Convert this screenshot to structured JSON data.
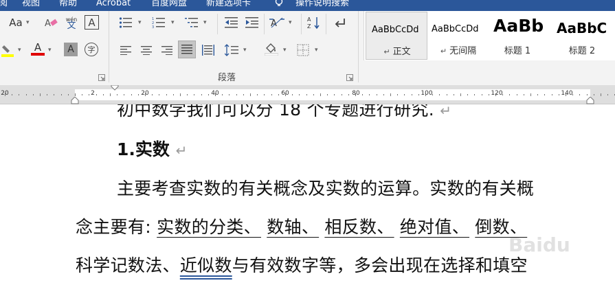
{
  "tabs": [
    "视图",
    "帮助",
    "Acrobat",
    "百度网盘",
    "新建选项卡",
    "操作说明搜索"
  ],
  "tabs_partial_left": "阅",
  "ribbon": {
    "font_size_label": "Aa",
    "phonetic_label": "wén\n文",
    "char_border_label": "A",
    "enclose_char_label": "字",
    "font_color_label": "A",
    "shading_label": "A",
    "paragraph_group_label": "段落"
  },
  "styles": [
    {
      "preview": "AaBbCcDd",
      "name": "正文",
      "selected": true
    },
    {
      "preview": "AaBbCcDd",
      "name": "无间隔",
      "selected": false
    },
    {
      "preview": "AaBb",
      "name": "标题 1",
      "selected": false
    },
    {
      "preview": "AaBbC",
      "name": "标题 2",
      "selected": false
    }
  ],
  "ruler": {
    "labels": [
      "20",
      "2",
      "20",
      "40",
      "60",
      "80",
      "100",
      "120",
      "140"
    ]
  },
  "document": {
    "line0": "初中数学我们可以分 18 个专题进行研究.",
    "heading": "1.实数",
    "p1_line1": "主要考查实数的有关概念及实数的运算。实数的有关概",
    "p1_line2_prefix": "念主要有: ",
    "p1_line2_terms": [
      "实数的分类、",
      "数轴、",
      "相反数、",
      "绝对值、",
      "倒数、"
    ],
    "p1_line3_a": "科学记数法、",
    "p1_line3_b": "近似数",
    "p1_line3_c": "与有效数字等，多会出现在选择和填空",
    "watermark": "Baidu"
  },
  "colors": {
    "tab_bar": "#2b579a",
    "ribbon_bg": "#f3f3f3",
    "highlight_yellow": "#ffff00",
    "font_color_red": "#e00000"
  }
}
